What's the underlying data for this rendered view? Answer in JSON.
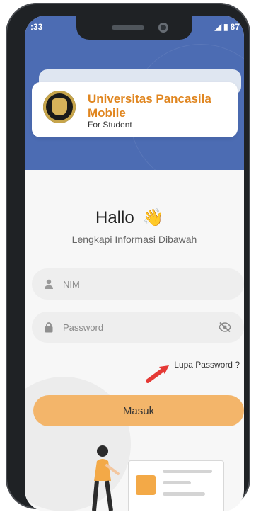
{
  "status_bar": {
    "time": ":33",
    "battery": "87"
  },
  "header": {
    "title_line1": "Universitas Pancasila",
    "title_line2": "Mobile",
    "subtitle": "For Student",
    "logo_icon": "university-seal-icon"
  },
  "greeting": {
    "text": "Hallo",
    "emoji": "👋"
  },
  "instruction": "Lengkapi Informasi Dibawah",
  "form": {
    "nim": {
      "placeholder": "NIM",
      "value": "",
      "icon": "user-icon"
    },
    "password": {
      "placeholder": "Password",
      "value": "",
      "icon": "lock-icon",
      "toggle_icon": "eye-off-icon"
    },
    "forgot_label": "Lupa Password ?",
    "submit_label": "Masuk"
  },
  "colors": {
    "header_bg": "#4c6cb3",
    "title_orange": "#e08620",
    "button_bg": "#f3b56a",
    "annotation_arrow": "#e53935"
  }
}
